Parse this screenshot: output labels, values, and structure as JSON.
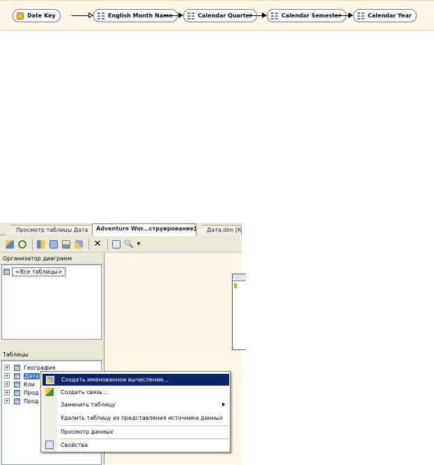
{
  "relationship_strip": {
    "nodes": [
      {
        "label": "Date Key",
        "icon": "key-attribute-icon"
      },
      {
        "label": "English Month Name",
        "icon": "attribute-icon"
      },
      {
        "label": "Calendar Quarter",
        "icon": "attribute-icon"
      },
      {
        "label": "Calendar Semester",
        "icon": "attribute-icon"
      },
      {
        "label": "Calendar Year",
        "icon": "attribute-icon"
      }
    ]
  },
  "tabs": [
    {
      "label": "Просмотр таблицы Дата"
    },
    {
      "label": "Adventure Wor...струирование]"
    },
    {
      "label": "Дата.dim [Ко"
    }
  ],
  "toolbar": {
    "buttons": [
      "add-table-icon",
      "refresh-icon",
      "new-relationship-icon",
      "named-query-icon",
      "diagram-icon",
      "add-named-calc-icon",
      "delete-icon",
      "zoom-fit-icon",
      "zoom-icon",
      "dropdown-arrow-icon"
    ]
  },
  "organizer": {
    "title": "Организатор диаграмм",
    "items": [
      {
        "label": "<Все таблицы>"
      }
    ]
  },
  "tables_pane": {
    "title": "Таблицы",
    "items": [
      {
        "label": "География"
      },
      {
        "label": "Дата"
      },
      {
        "label": "Кли"
      },
      {
        "label": "Прод"
      },
      {
        "label": "Прод"
      }
    ]
  },
  "context_menu": {
    "items": [
      {
        "label": "Создать именованное вычисление...",
        "icon": "named-calculation-icon"
      },
      {
        "label": "Создать связь...",
        "icon": "new-relationship-icon"
      },
      {
        "label": "Заменить таблицу",
        "icon": ""
      },
      {
        "label": "Удалить таблицу из представления источника данных",
        "icon": ""
      },
      {
        "label": "Просмотр данных",
        "icon": ""
      },
      {
        "label": "Свойства",
        "icon": "properties-icon"
      }
    ]
  },
  "colors": {
    "canvas": "#fdf8e6",
    "selection": "#316ac5",
    "menu_highlight": "#0a246a"
  }
}
